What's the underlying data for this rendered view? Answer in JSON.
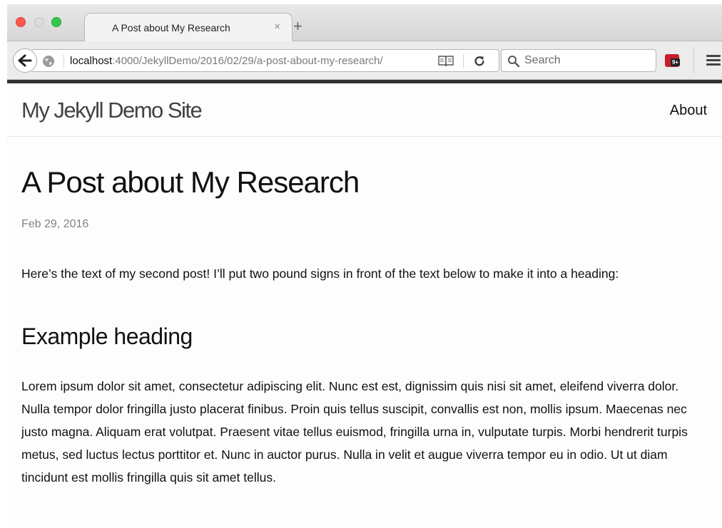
{
  "browser": {
    "tab": {
      "title": "A Post about My Research",
      "close_glyph": "×"
    },
    "new_tab_glyph": "+",
    "url": {
      "host": "localhost",
      "rest": ":4000/JekyllDemo/2016/02/29/a-post-about-my-research/"
    },
    "search": {
      "placeholder": "Search"
    },
    "extension_badge": "9+"
  },
  "site": {
    "title": "My Jekyll Demo Site",
    "nav": {
      "about": "About"
    },
    "header_bar_color": "#333333"
  },
  "post": {
    "title": "A Post about My Research",
    "date": "Feb 29, 2016",
    "intro": "Here’s the text of my second post! I’ll put two pound signs in front of the text below to make it into a heading:",
    "heading": "Example heading",
    "body": "Lorem ipsum dolor sit amet, consectetur adipiscing elit. Nunc est est, dignissim quis nisi sit amet, eleifend viverra dolor. Nulla tempor dolor fringilla justo placerat finibus. Proin quis tellus suscipit, convallis est non, mollis ipsum. Maecenas nec justo magna. Aliquam erat volutpat. Praesent vitae tellus euismod, fringilla urna in, vulputate turpis. Morbi hendrerit turpis metus, sed luctus lectus porttitor et. Nunc in auctor purus. Nulla in velit et augue viverra tempor eu in odio. Ut ut diam tincidunt est mollis fringilla quis sit amet tellus."
  },
  "icons": {
    "close_window": "red-traffic-light",
    "minimize_window": "yellow-traffic-light",
    "zoom_window": "green-traffic-light",
    "back": "back-arrow-icon",
    "site_info": "globe-icon",
    "reader_view": "reader-view-icon",
    "reload": "reload-icon",
    "search": "search-icon",
    "extension": "extension-icon",
    "menu": "hamburger-menu-icon"
  }
}
